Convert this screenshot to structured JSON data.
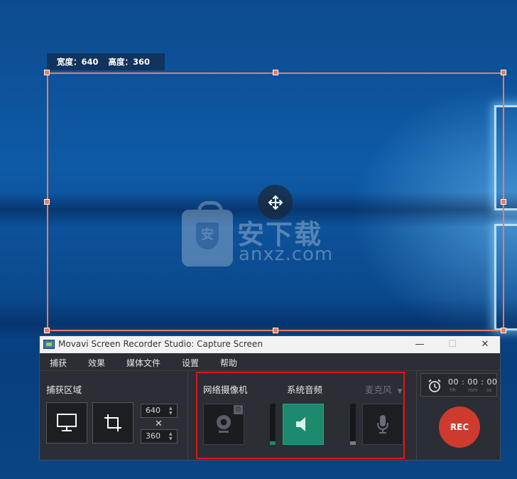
{
  "capture_overlay": {
    "width_label": "宽度：640",
    "height_label": "高度：360"
  },
  "watermark": {
    "title": "安下载",
    "domain": "anxz.com",
    "shield_char": "安"
  },
  "window": {
    "title": "Movavi Screen Recorder Studio: Capture Screen",
    "minimize_glyph": "—",
    "maximize_glyph": "☐",
    "close_glyph": "✕"
  },
  "menu": [
    "捕获",
    "效果",
    "媒体文件",
    "设置",
    "帮助"
  ],
  "capture_area": {
    "label": "捕获区域",
    "width_value": "640",
    "height_value": "360",
    "times_glyph": "✕"
  },
  "sources": {
    "webcam_label": "网络摄像机",
    "system_audio_label": "系统音频",
    "microphone_label": "麦克风",
    "microphone_dropdown_glyph": "▼",
    "system_audio_level": 0.08,
    "microphone_level": 0.08
  },
  "timer": {
    "hours": "00",
    "minutes": "00",
    "seconds": "00",
    "separator": ":",
    "unit_hours": "hh",
    "unit_minutes": "mm",
    "unit_seconds": "ss"
  },
  "record_button_label": "REC",
  "colors": {
    "frame": "#f07a5c",
    "highlight_box": "#e2141a",
    "audio_active": "#1d8a6d",
    "rec_button": "#cf3a2f"
  }
}
